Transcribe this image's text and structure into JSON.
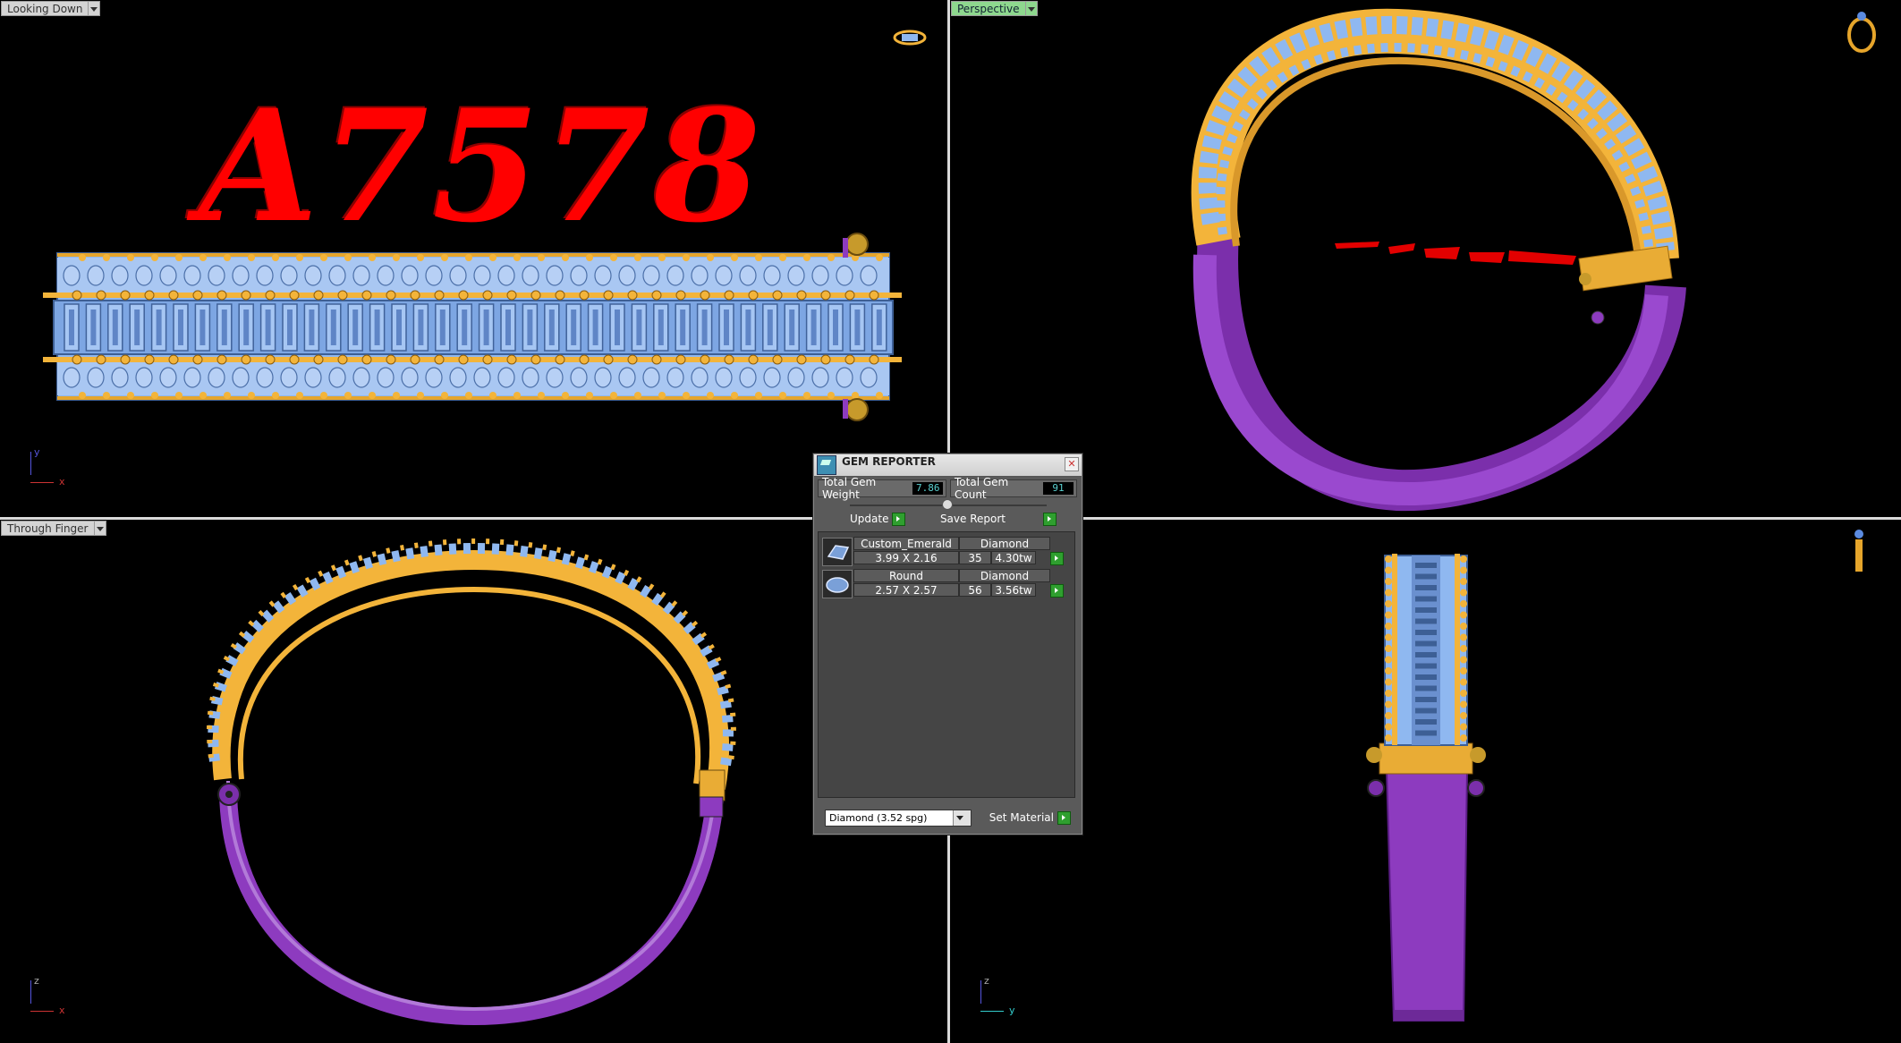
{
  "viewports": {
    "top_left": {
      "label": "Looking Down",
      "axis": [
        "y",
        "x"
      ]
    },
    "top_right": {
      "label": "Perspective"
    },
    "bottom_left": {
      "label": "Through Finger",
      "axis": [
        "z",
        "x"
      ]
    },
    "bottom_right": {
      "axis": [
        "z",
        "y"
      ]
    }
  },
  "model_text": "A7578",
  "colors": {
    "gold": "#f3b43a",
    "gem_blue": "#8fb8f0",
    "purple": "#8d3bbf",
    "text_red": "#ff0000",
    "background": "#000000"
  },
  "gem_reporter": {
    "title": "GEM REPORTER",
    "total_weight_label": "Total Gem Weight",
    "total_weight_value": "7.86",
    "total_count_label": "Total Gem Count",
    "total_count_value": "91",
    "update_label": "Update",
    "save_report_label": "Save Report",
    "gems": [
      {
        "shape": "Custom_Emerald",
        "material": "Diamond",
        "size": "3.99 X 2.16",
        "count": "35",
        "weight": "4.30tw"
      },
      {
        "shape": "Round",
        "material": "Diamond",
        "size": "2.57 X 2.57",
        "count": "56",
        "weight": "3.56tw"
      }
    ],
    "material_select": "Diamond    (3.52 spg)",
    "set_material_label": "Set Material"
  }
}
